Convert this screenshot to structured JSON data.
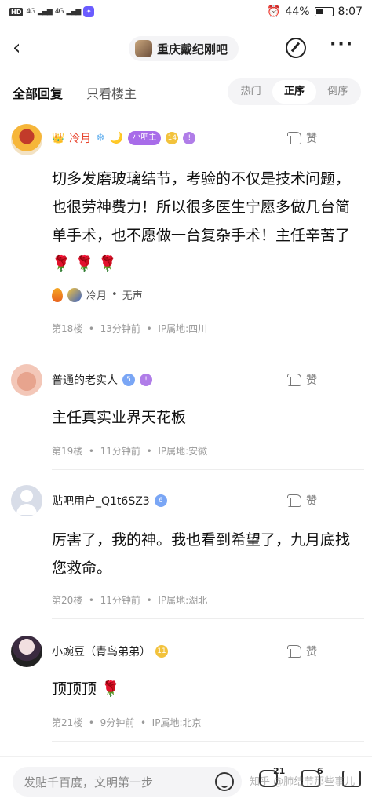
{
  "status_bar": {
    "hd": "HD",
    "net1": "4G",
    "net2": "4G",
    "battery": "44%",
    "time": "8:07"
  },
  "header": {
    "forum_name": "重庆戴纪刚吧"
  },
  "tabs": {
    "all": "全部回复",
    "owner_only": "只看楼主",
    "sort_options": [
      "热门",
      "正序",
      "倒序"
    ]
  },
  "posts": [
    {
      "username": "冷月",
      "role_badge": "小吧主",
      "level": "14",
      "like_label": "赞",
      "text": "切多发磨玻璃结节，考验的不仅是技术问题，也很劳神费力！所以很多医生宁愿多做几台简单手术，也不愿做一台复杂手术！主任辛苦了",
      "sub_username": "冷月",
      "sub_text": "无声",
      "floor": "第18楼",
      "time": "13分钟前",
      "ip": "IP属地:四川"
    },
    {
      "username": "普通的老实人",
      "level": "5",
      "like_label": "赞",
      "text": "主任真实业界天花板",
      "floor": "第19楼",
      "time": "11分钟前",
      "ip": "IP属地:安徽"
    },
    {
      "username": "贴吧用户_Q1t6SZ3",
      "level": "6",
      "like_label": "赞",
      "text": "厉害了，我的神。我也看到希望了，九月底找您救命。",
      "floor": "第20楼",
      "time": "11分钟前",
      "ip": "IP属地:湖北"
    },
    {
      "username": "小豌豆（青鸟弟弟）",
      "level": "11",
      "like_label": "赞",
      "text": "顶顶顶",
      "floor": "第21楼",
      "time": "9分钟前",
      "ip": "IP属地:北京"
    }
  ],
  "bottom_bar": {
    "reply_placeholder": "发贴千百度，文明第一步",
    "comment_count": "21",
    "like_count": "6",
    "watermark": "知乎 @肺结节那些事儿"
  },
  "colors": {
    "accent_red": "#e8432c",
    "badge_purple": "#a86ce9"
  }
}
